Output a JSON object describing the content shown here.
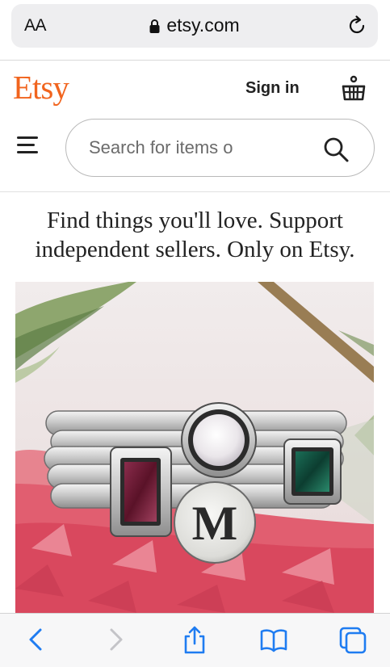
{
  "browser": {
    "text_size_label": "AA",
    "url": "etsy.com"
  },
  "header": {
    "logo": "Etsy",
    "sign_in_label": "Sign in"
  },
  "search": {
    "placeholder": "Search for items o"
  },
  "hero": {
    "tagline_line1": "Find things you'll love. Support",
    "tagline_line2": "independent sellers. Only on Etsy.",
    "ring_letter": "M"
  },
  "colors": {
    "brand": "#f1641e",
    "safari_accent": "#1f7cf1"
  },
  "icons": [
    "lock-icon",
    "reload-icon",
    "basket-icon",
    "menu-icon",
    "search-icon",
    "back-icon",
    "forward-icon",
    "share-icon",
    "bookmarks-icon",
    "tabs-icon"
  ]
}
